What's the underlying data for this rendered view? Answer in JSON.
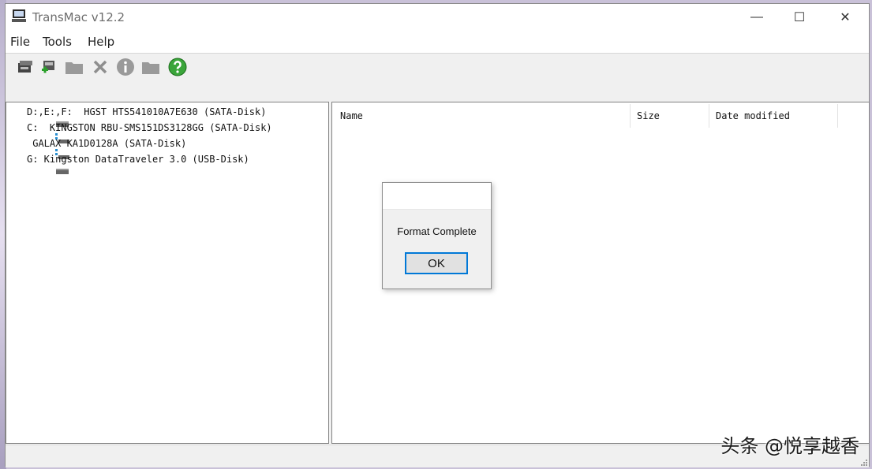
{
  "window": {
    "title": "TransMac v12.2"
  },
  "window_controls": {
    "minimize": "—",
    "maximize": "☐",
    "close": "✕"
  },
  "menu": {
    "items": [
      "File",
      "Tools",
      "Help"
    ]
  },
  "toolbar": {
    "buttons": [
      "disk-image-icon",
      "add-disk-icon",
      "folder-icon",
      "delete-icon",
      "info-icon",
      "folder-icon",
      "help-icon"
    ]
  },
  "disks": [
    {
      "label": "D:,E:,F:  HGST HTS541010A7E630 (SATA-Disk)",
      "icon": "hdd-icon"
    },
    {
      "label": "C:  KINGSTON RBU-SMS151DS3128GG (SATA-Disk)",
      "icon": "ssd-icon"
    },
    {
      "label": " GALAX KA1D0128A (SATA-Disk)",
      "icon": "ssd-icon"
    },
    {
      "label": "G: Kingston DataTraveler 3.0 (USB-Disk)",
      "icon": "hdd-icon"
    }
  ],
  "columns": [
    "Name",
    "Size",
    "Date modified"
  ],
  "dialog": {
    "message": "Format Complete",
    "ok_label": "OK"
  },
  "watermark": "头条 @悦享越香",
  "colors": {
    "accent": "#0078d7",
    "help_green": "#3aa53a"
  }
}
